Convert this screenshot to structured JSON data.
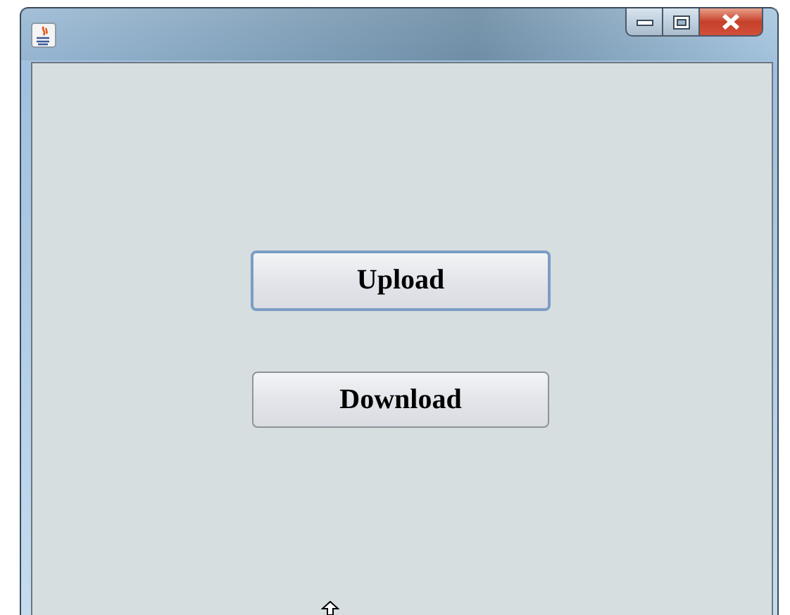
{
  "window": {
    "controls": [
      {
        "kind": "minimize"
      },
      {
        "kind": "maximize"
      },
      {
        "kind": "close"
      }
    ]
  },
  "buttons": [
    {
      "label": "Upload",
      "focused": true
    },
    {
      "label": "Download",
      "focused": false
    }
  ]
}
